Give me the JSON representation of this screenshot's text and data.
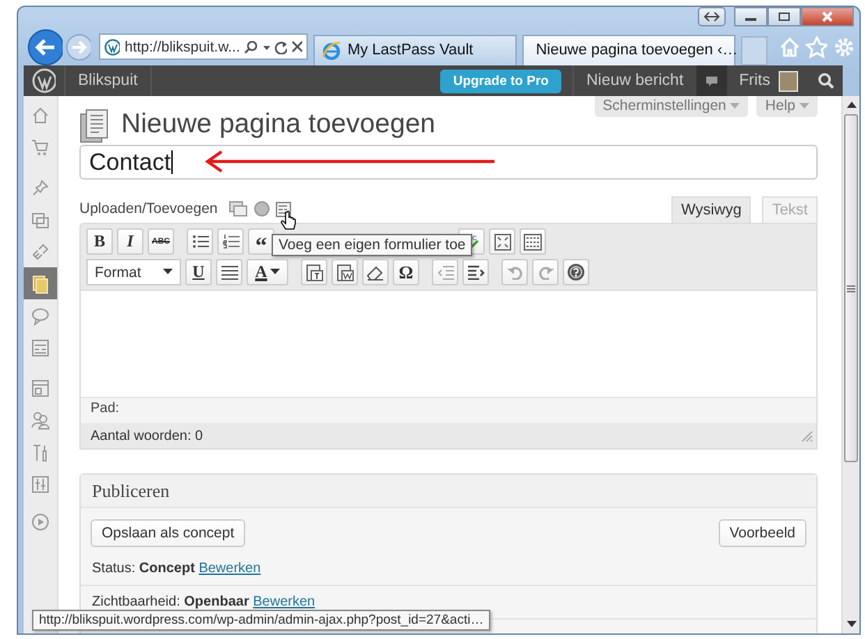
{
  "browser": {
    "address": "http://blikspuit.w...",
    "tabs": [
      {
        "title": "My LastPass Vault",
        "selected": false
      },
      {
        "title": "Nieuwe pagina toevoegen ‹…",
        "selected": true
      }
    ]
  },
  "admin_bar": {
    "site": "Blikspuit",
    "upgrade": "Upgrade to Pro",
    "new_post": "Nieuw bericht",
    "user": "Frits"
  },
  "sidebar": [
    {
      "selected": false
    },
    {
      "selected": false
    },
    {
      "selected": false
    },
    {
      "selected": false
    },
    {
      "selected": false
    },
    {
      "selected": true
    },
    {
      "selected": false
    },
    {
      "selected": false
    },
    {
      "selected": false
    },
    {
      "selected": false
    },
    {
      "selected": false
    },
    {
      "selected": false
    },
    {
      "selected": false
    }
  ],
  "screen_options": "Scherminstellingen",
  "help": "Help",
  "heading": "Nieuwe pagina toevoegen",
  "title_value": "Contact",
  "media_label": "Uploaden/Toevoegen",
  "tooltip": "Voeg een eigen formulier toe",
  "editor_tabs": [
    {
      "label": "Wysiwyg",
      "selected": true
    },
    {
      "label": "Tekst",
      "selected": false
    }
  ],
  "toolbar": {
    "bold": "B",
    "italic": "I",
    "strikethrough": "ABC",
    "blockquote": "“",
    "format": "Format",
    "underline": "U",
    "text_color": "A",
    "special_character": "Ω"
  },
  "path_label": "Pad:",
  "word_count": "Aantal woorden: 0",
  "publish": {
    "title": "Publiceren",
    "save_draft": "Opslaan als concept",
    "preview": "Voorbeeld",
    "lines": [
      {
        "text": "Status: **Concept**",
        "link": "Bewerken"
      },
      {
        "text": "Zichtbaarheid: **Openbaar**",
        "link": "Bewerken"
      }
    ]
  },
  "status_url": "http://blikspuit.wordpress.com/wp-admin/admin-ajax.php?post_id=27&acti…"
}
